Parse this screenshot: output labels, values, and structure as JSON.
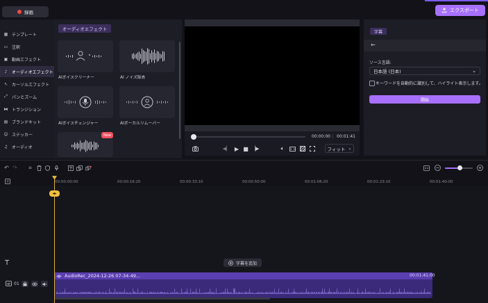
{
  "header": {
    "record_label": "録画",
    "export_label": "エクスポート"
  },
  "sidebar": {
    "items": [
      {
        "label": "テンプレート",
        "icon": "template-icon",
        "glyph": "▦"
      },
      {
        "label": "注釈",
        "icon": "annotation-icon",
        "glyph": "▭"
      },
      {
        "label": "動画エフェクト",
        "icon": "video-effect-icon",
        "glyph": "▣"
      },
      {
        "label": "オーディオエフェクト",
        "icon": "audio-effect-icon",
        "glyph": "♪",
        "active": true
      },
      {
        "label": "カーソルエフェクト",
        "icon": "cursor-effect-icon",
        "glyph": "↖"
      },
      {
        "label": "パンとズーム",
        "icon": "pan-zoom-icon",
        "glyph": "⤢"
      },
      {
        "label": "トランジション",
        "icon": "transition-icon",
        "glyph": "⧓"
      },
      {
        "label": "ブランドキット",
        "icon": "brand-kit-icon",
        "glyph": "▤"
      },
      {
        "label": "ステッカー",
        "icon": "sticker-icon",
        "glyph": "☺"
      },
      {
        "label": "オーディオ",
        "icon": "audio-icon",
        "glyph": "♫"
      }
    ]
  },
  "effects": {
    "title": "オーディオエフェクト",
    "cards": [
      {
        "label": "AIボイスクリーナー",
        "icon": "voice-cleaner-icon"
      },
      {
        "label": "AI ノイズ除去",
        "icon": "noise-removal-icon"
      },
      {
        "label": "AIボイスチェンジャー",
        "icon": "voice-changer-icon"
      },
      {
        "label": "AIボーカルリムーバー",
        "icon": "vocal-remover-icon"
      },
      {
        "label": "",
        "icon": "new-effect-icon",
        "badge": "New"
      }
    ]
  },
  "preview": {
    "current_time": "00:00:00",
    "total_time": "00:01:41",
    "fit_label": "フィット"
  },
  "subtitle_panel": {
    "tab": "字幕",
    "source_lang_label": "ソース言語:",
    "source_lang_value": "日本語 (日本)",
    "keyword_checkbox_label": "キーワードを自動的に識別して、ハイライト表示します。",
    "keyword_checked": false,
    "start_button": "開始"
  },
  "timeline": {
    "ticks": [
      "00:00:00:00",
      "00:00:16:20",
      "00:00:33:10",
      "00:00:50:00",
      "00:01:06:20",
      "00:01:23:10",
      "00:01:40:00"
    ],
    "zoom_level": 0.5,
    "add_subtitle_label": "字幕を追加",
    "track_number": "01",
    "clip": {
      "name": "AudioRec_2024-12-26 07-34-49...",
      "duration": "00:01:41:00"
    }
  },
  "colors": {
    "accent": "#a770ff",
    "playhead": "#e0b040",
    "record": "#f04848",
    "badge": "#f0505f"
  }
}
